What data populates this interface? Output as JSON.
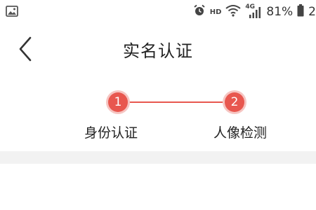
{
  "status_bar": {
    "image_icon": "image-icon",
    "alarm_icon": "alarm-icon",
    "hd_label": "HD",
    "wifi_icon": "wifi-icon",
    "network_label": "4G",
    "signal_icon": "signal-icon",
    "battery_percent": "81%",
    "battery_icon": "battery-icon",
    "time_partial": "2"
  },
  "nav": {
    "back_icon": "chevron-left-icon",
    "title": "实名认证"
  },
  "steps": [
    {
      "number": "1",
      "label": "身份认证"
    },
    {
      "number": "2",
      "label": "人像检测"
    }
  ],
  "colors": {
    "accent": "#e8574f",
    "divider": "#f2f2f2"
  }
}
